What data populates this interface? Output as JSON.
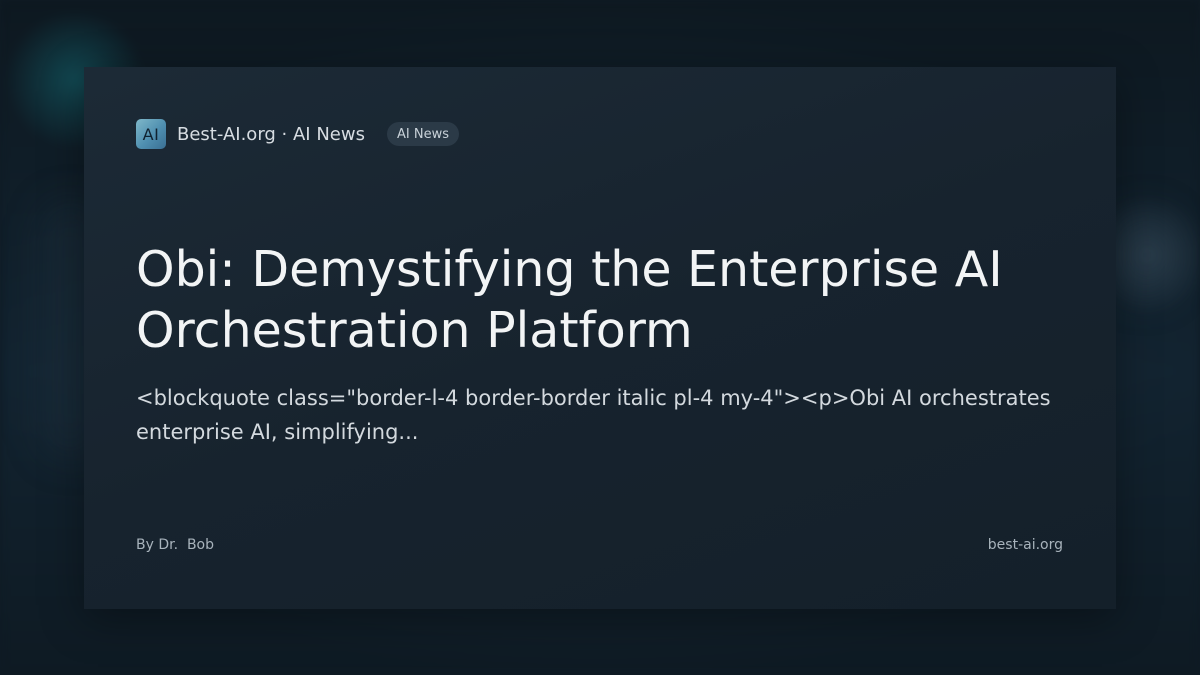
{
  "header": {
    "logo_text": "AI",
    "site_name": "Best-AI.org · AI News",
    "category_badge": "AI News"
  },
  "article": {
    "title": "Obi: Demystifying the Enterprise AI Orchestration Platform",
    "excerpt": "<blockquote class=\"border-l-4 border-border italic pl-4 my-4\"><p>Obi AI orchestrates enterprise AI, simplifying..."
  },
  "footer": {
    "author": "By Dr.  Bob",
    "domain": "best-ai.org"
  },
  "colors": {
    "background": "#0f1b24",
    "card": "#1a2833",
    "title_text": "#f2f4f5",
    "badge_bg": "#2b3a47",
    "logo_gradient_start": "#7fb8c9",
    "logo_gradient_end": "#3a6f93"
  }
}
